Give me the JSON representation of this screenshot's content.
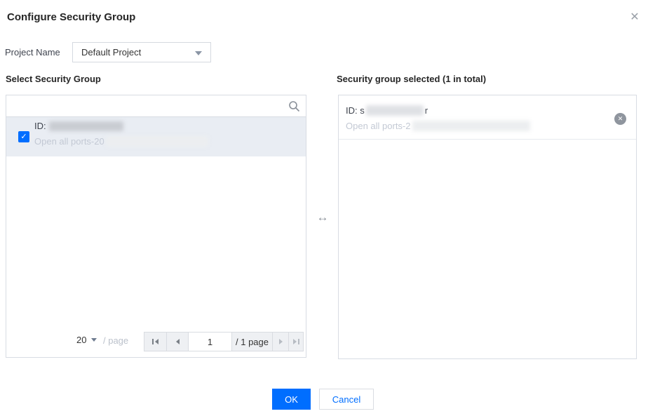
{
  "dialog": {
    "title": "Configure Security Group",
    "close_glyph": "✕"
  },
  "project": {
    "label": "Project Name",
    "selected_option": "Default Project"
  },
  "left_panel": {
    "header": "Select Security Group",
    "search": {
      "value": "",
      "placeholder": ""
    },
    "item": {
      "checked": true,
      "check_glyph": "✓",
      "id_label": "ID:",
      "name_prefix": "Open all ports-20"
    },
    "pagination": {
      "page_size": "20",
      "per_page_label": "/ page",
      "page_value": "1",
      "total_label": "/ 1 page"
    }
  },
  "transfer": {
    "arrow_glyph": "↔"
  },
  "right_panel": {
    "header": "Security group selected (1 in total)",
    "item": {
      "id_prefix": "ID: s",
      "id_suffix": "r",
      "name_prefix": "Open all ports-2",
      "remove_glyph": "✕"
    }
  },
  "footer": {
    "ok_label": "OK",
    "cancel_label": "Cancel"
  },
  "colors": {
    "accent_blue": "#006eff",
    "selected_row_bg": "#e9edf3",
    "panel_border": "#d8dce3",
    "muted_text": "#c3c9d4",
    "icon_gray": "#8f959e"
  }
}
